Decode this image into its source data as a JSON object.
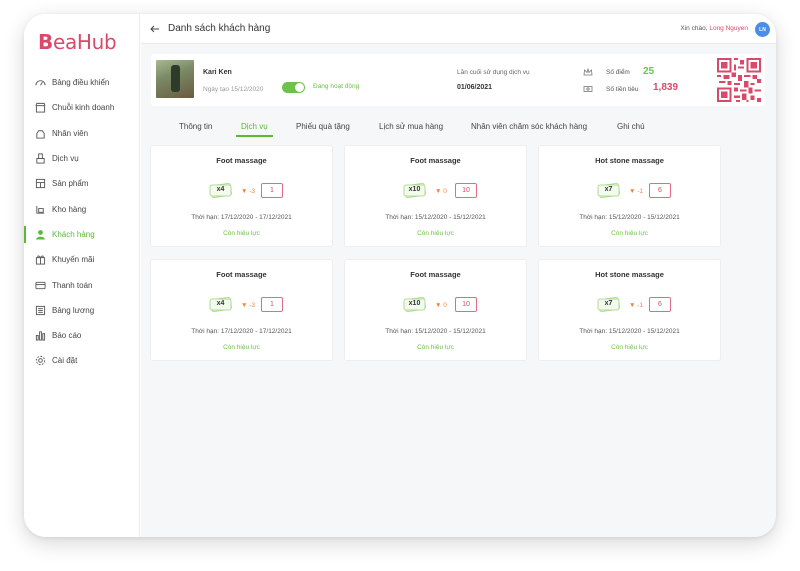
{
  "brand": {
    "logo_text_b": "B",
    "logo_text_rest": "eaHub",
    "color": "#d94a6a"
  },
  "sidebar": {
    "items": [
      {
        "label": "Bảng điều khiển",
        "icon": "dashboard-icon"
      },
      {
        "label": "Chuỗi kinh doanh",
        "icon": "store-icon"
      },
      {
        "label": "Nhân viên",
        "icon": "staff-icon"
      },
      {
        "label": "Dịch vụ",
        "icon": "service-icon"
      },
      {
        "label": "Sản phẩm",
        "icon": "product-icon"
      },
      {
        "label": "Kho hàng",
        "icon": "warehouse-icon"
      },
      {
        "label": "Khách hàng",
        "icon": "customer-icon",
        "active": true
      },
      {
        "label": "Khuyến mãi",
        "icon": "gift-icon"
      },
      {
        "label": "Thanh toán",
        "icon": "payment-icon"
      },
      {
        "label": "Bảng lương",
        "icon": "payroll-icon"
      },
      {
        "label": "Báo cáo",
        "icon": "report-icon"
      },
      {
        "label": "Cài đặt",
        "icon": "settings-icon"
      }
    ]
  },
  "header": {
    "title": "Danh sách khách hàng",
    "greeting": "Xin chào,",
    "user_name": "Long Nguyen",
    "avatar_initials": "LN"
  },
  "customer": {
    "name": "Kari Ken",
    "created": "Ngày tạo 15/12/2020",
    "status": "Đang hoạt động",
    "last_used_label": "Lần cuối sử dụng dịch vụ",
    "last_used_value": "01/06/2021",
    "points_label": "Số điểm",
    "points_value": "25",
    "spent_label": "Số tiền tiêu",
    "spent_value": "1,839"
  },
  "tabs": [
    {
      "label": "Thông tin"
    },
    {
      "label": "Dịch vụ",
      "active": true
    },
    {
      "label": "Phiếu quà tặng"
    },
    {
      "label": "Lịch sử mua hàng"
    },
    {
      "label": "Nhân viên chăm sóc khách hàng"
    },
    {
      "label": "Ghi chú"
    }
  ],
  "services": [
    {
      "name": "Foot massage",
      "qty": "x4",
      "delta": "-3",
      "remaining": "1",
      "period": "Thời hạn: 17/12/2020 - 17/12/2021",
      "status": "Còn hiệu lực"
    },
    {
      "name": "Foot massage",
      "qty": "x10",
      "delta": "0",
      "remaining": "10",
      "period": "Thời hạn: 15/12/2020 - 15/12/2021",
      "status": "Còn hiệu lực"
    },
    {
      "name": "Hot stone massage",
      "qty": "x7",
      "delta": "-1",
      "remaining": "6",
      "period": "Thời hạn: 15/12/2020 - 15/12/2021",
      "status": "Còn hiệu lực"
    },
    {
      "name": "Foot massage",
      "qty": "x4",
      "delta": "-3",
      "remaining": "1",
      "period": "Thời hạn: 17/12/2020 - 17/12/2021",
      "status": "Còn hiệu lực"
    },
    {
      "name": "Foot massage",
      "qty": "x10",
      "delta": "0",
      "remaining": "10",
      "period": "Thời hạn: 15/12/2020 - 15/12/2021",
      "status": "Còn hiệu lực"
    },
    {
      "name": "Hot stone massage",
      "qty": "x7",
      "delta": "-1",
      "remaining": "6",
      "period": "Thời hạn: 15/12/2020 - 15/12/2021",
      "status": "Còn hiệu lực"
    }
  ],
  "colors": {
    "accent_green": "#5ab937",
    "accent_pink": "#d94a6a",
    "delta_orange": "#f0833a"
  }
}
